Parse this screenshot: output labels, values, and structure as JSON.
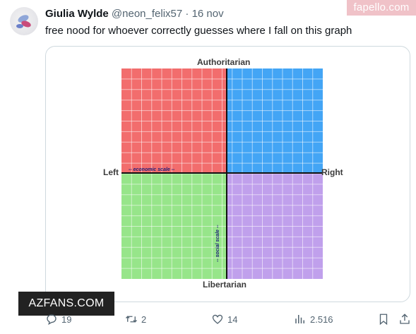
{
  "tweet": {
    "display_name": "Giulia Wylde",
    "handle": "@neon_felix57",
    "separator": "·",
    "date": "16 nov",
    "text": "free nood for whoever correctly guesses where I fall on this graph"
  },
  "compass": {
    "top_label": "Authoritarian",
    "bottom_label": "Libertarian",
    "left_label": "Left",
    "right_label": "Right",
    "economic_scale_label": "-- economic scale --",
    "social_scale_label": "-- social scale --",
    "colors": {
      "top_left": "#f26d6d",
      "top_right": "#43a5f5",
      "bottom_left": "#97e58a",
      "bottom_right": "#c0a0ec"
    }
  },
  "actions": {
    "reply_count": "19",
    "retweet_count": "2",
    "like_count": "14",
    "views_count": "2.516"
  },
  "watermarks": {
    "top": "fapello.com",
    "bottom": "AZFANS.COM"
  },
  "icons": {
    "more": "more-icon",
    "reply": "reply-icon",
    "retweet": "retweet-icon",
    "like": "heart-icon",
    "views": "views-icon",
    "bookmark": "bookmark-icon",
    "share": "share-icon"
  }
}
